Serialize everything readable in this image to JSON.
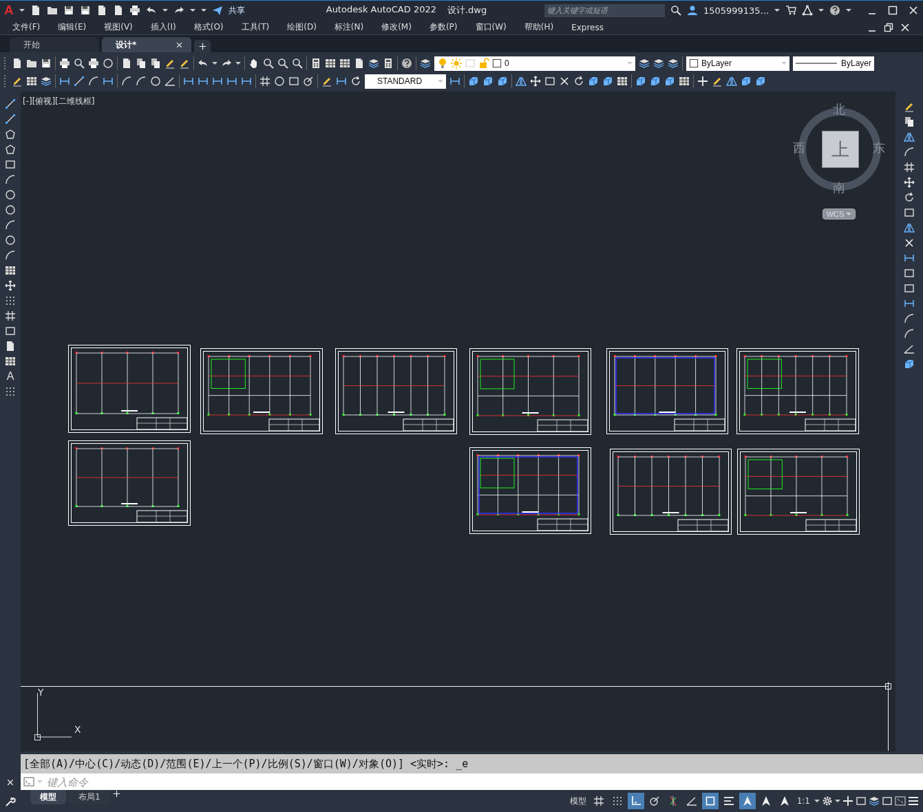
{
  "title_bar": {
    "logo": "A",
    "share": "共享",
    "app_title": "Autodesk AutoCAD 2022",
    "file_title": "设计.dwg",
    "search": {
      "placeholder": "键入关键字或短语"
    },
    "user": "1505999135..."
  },
  "menu": [
    "文件(F)",
    "编辑(E)",
    "视图(V)",
    "插入(I)",
    "格式(O)",
    "工具(T)",
    "绘图(D)",
    "标注(N)",
    "修改(M)",
    "参数(P)",
    "窗口(W)",
    "帮助(H)",
    "Express"
  ],
  "file_tabs": [
    {
      "label": "开始",
      "selected": false
    },
    {
      "label": "设计*",
      "selected": true
    }
  ],
  "layer_toolbar": {
    "layer": "0",
    "color_label": "ByLayer",
    "linetype": "ByLayer"
  },
  "style_toolbar": {
    "text_style": "STANDARD"
  },
  "draw_toolbar": {
    "text_glyph": "A"
  },
  "viewport": {
    "label": "[-][俯视][二维线框]",
    "viewcube": {
      "top": "上",
      "north": "北",
      "south": "南",
      "east": "东",
      "west": "西",
      "ucs": "WCS"
    },
    "ucs_icon": {
      "y": "Y",
      "x": "X"
    }
  },
  "command_line": {
    "history": "[全部(A)/中心(C)/动态(D)/范围(E)/上一个(P)/比例(S)/窗口(W)/对象(O)] <实时>: _e",
    "placeholder": "键入命令"
  },
  "layout_tabs": [
    {
      "label": "模型",
      "selected": true
    },
    {
      "label": "布局1",
      "selected": false
    }
  ],
  "status_bar": {
    "space": "模型",
    "toggles": [
      {
        "kind": "grid",
        "on": false
      },
      {
        "kind": "snap",
        "on": false
      },
      {
        "kind": "ortho",
        "on": true
      },
      {
        "kind": "polar",
        "on": false
      },
      {
        "kind": "isodraft",
        "on": false
      },
      {
        "kind": "angle",
        "on": false
      },
      {
        "kind": "osnap",
        "on": true
      },
      {
        "kind": "lineweight",
        "on": false
      },
      {
        "kind": "annotation",
        "on": true
      },
      {
        "kind": "autoscale",
        "on": false
      },
      {
        "kind": "annoscale",
        "on": false
      }
    ],
    "scale": "1:1"
  }
}
